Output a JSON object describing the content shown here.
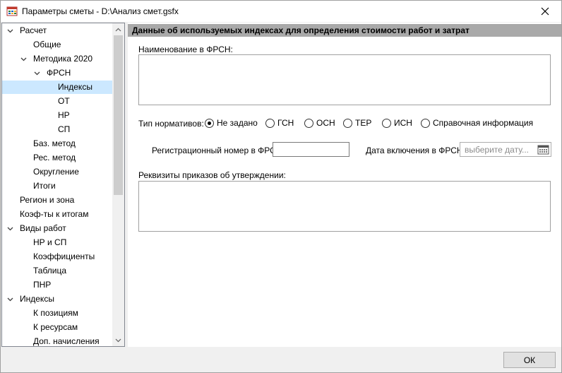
{
  "window": {
    "title": "Параметры сметы - D:\\Анализ смет.gsfx"
  },
  "tree": {
    "items": [
      {
        "label": "Расчет",
        "level": 0,
        "expanded": true
      },
      {
        "label": "Общие",
        "level": 1
      },
      {
        "label": "Методика 2020",
        "level": 1,
        "expanded": true
      },
      {
        "label": "ФРСН",
        "level": 2,
        "expanded": true
      },
      {
        "label": "Индексы",
        "level": 3,
        "selected": true
      },
      {
        "label": "ОТ",
        "level": 3
      },
      {
        "label": "НР",
        "level": 3
      },
      {
        "label": "СП",
        "level": 3
      },
      {
        "label": "Баз. метод",
        "level": 1
      },
      {
        "label": "Рес. метод",
        "level": 1
      },
      {
        "label": "Округление",
        "level": 1
      },
      {
        "label": "Итоги",
        "level": 1
      },
      {
        "label": "Регион и зона",
        "level": 0
      },
      {
        "label": "Коэф-ты к итогам",
        "level": 0
      },
      {
        "label": "Виды работ",
        "level": 0,
        "expanded": true
      },
      {
        "label": "НР и СП",
        "level": 1
      },
      {
        "label": "Коэффициенты",
        "level": 1
      },
      {
        "label": "Таблица",
        "level": 1
      },
      {
        "label": "ПНР",
        "level": 1
      },
      {
        "label": "Индексы",
        "level": 0,
        "expanded": true
      },
      {
        "label": "К позициям",
        "level": 1
      },
      {
        "label": "К ресурсам",
        "level": 1
      },
      {
        "label": "Доп. начисления",
        "level": 1
      }
    ]
  },
  "panel": {
    "header": "Данные об используемых индексах для определения стоимости работ и затрат",
    "name_label": "Наименование в ФРСН:",
    "name_value": "",
    "norm_type_label": "Тип нормативов:",
    "norm_types": [
      {
        "label": "Не задано",
        "checked": true
      },
      {
        "label": "ГСН",
        "checked": false
      },
      {
        "label": "ОСН",
        "checked": false
      },
      {
        "label": "ТЕР",
        "checked": false
      },
      {
        "label": "ИСН",
        "checked": false
      },
      {
        "label": "Справочная информация",
        "checked": false
      }
    ],
    "reg_number_label": "Регистрационный номер в ФРСН:",
    "reg_number_value": "",
    "date_label": "Дата включения в ФРСН:",
    "date_placeholder": "выберите дату...",
    "requisites_label": "Реквизиты приказов об утверждении:",
    "requisites_value": ""
  },
  "footer": {
    "ok_label": "ОК"
  }
}
